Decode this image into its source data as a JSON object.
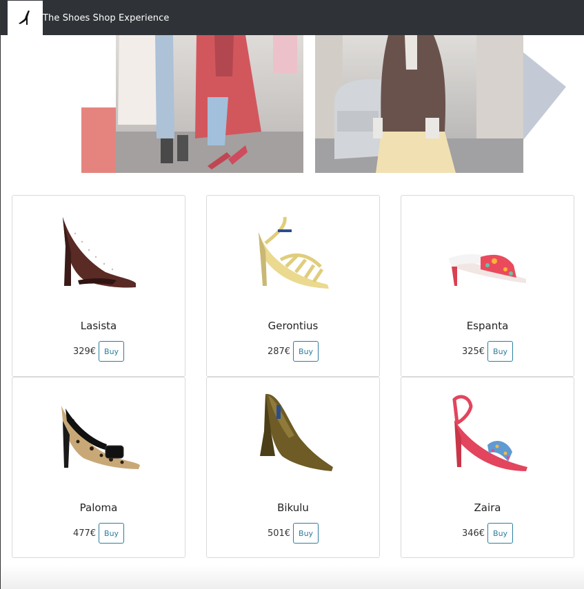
{
  "navbar": {
    "brand": "The Shoes Shop Experience",
    "logo_icon": "high-heel-icon"
  },
  "colors": {
    "navbar_bg": "#2f3337",
    "accent_block": "#e5847f",
    "arrow": "#c3cad6",
    "buy_button": "#2a7d9c"
  },
  "hero": {
    "images": [
      "street-style-red-coat-photo",
      "street-style-blazer-photo"
    ],
    "next_arrow_icon": "arrow-right-icon"
  },
  "products": [
    {
      "name": "Lasista",
      "price": "329€",
      "buy_label": "Buy",
      "color": "#5a2a25",
      "style": "studded-peep-toe-pump"
    },
    {
      "name": "Gerontius",
      "price": "287€",
      "buy_label": "Buy",
      "color": "#ead98f",
      "style": "strappy-sandal"
    },
    {
      "name": "Espanta",
      "price": "325€",
      "buy_label": "Buy",
      "color": "#e94b5c",
      "style": "floral-mule"
    },
    {
      "name": "Paloma",
      "price": "477€",
      "buy_label": "Buy",
      "color": "#c9a878",
      "style": "leopard-buckle-pump"
    },
    {
      "name": "Bikulu",
      "price": "501€",
      "buy_label": "Buy",
      "color": "#6e5b25",
      "style": "metallic-pump"
    },
    {
      "name": "Zaira",
      "price": "346€",
      "buy_label": "Buy",
      "color": "#e2455d",
      "style": "slingback-sandal"
    }
  ]
}
